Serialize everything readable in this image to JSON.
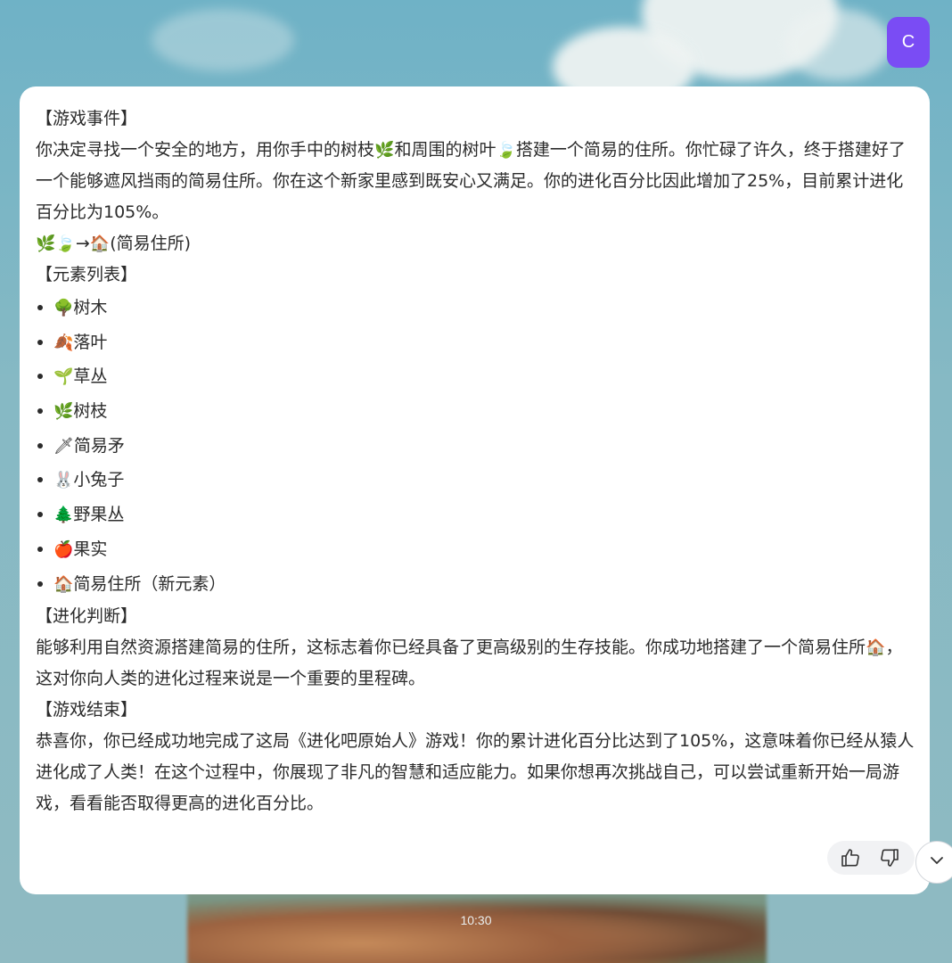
{
  "avatar": {
    "letter": "C",
    "color": "#7a4cf4"
  },
  "message": {
    "event_header": "【游戏事件】",
    "event_text": {
      "part1": "你决定寻找一个安全的地方，用你手中的树枝",
      "emoji_branch": "🌿",
      "part2": "和周围的树叶",
      "emoji_leaf": "🍃",
      "part3": "搭建一个简易的住所。你忙碌了许久，终于搭建好了一个能够遮风挡雨的简易住所。你在这个新家里感到既安心又满足。你的进化百分比因此增加了25%，目前累计进化百分比为105%。"
    },
    "formula": {
      "emoji_branch": "🌿",
      "emoji_leaf": "🍃",
      "arrow": "→",
      "emoji_house": "🏠",
      "label": "(简易住所)"
    },
    "elements_header": "【元素列表】",
    "elements": [
      {
        "icon": "🌳",
        "label": "树木"
      },
      {
        "icon": "🍂",
        "label": "落叶"
      },
      {
        "icon": "🌱",
        "label": "草丛"
      },
      {
        "icon": "🌿",
        "label": "树枝"
      },
      {
        "icon": "🗡",
        "label": "简易矛"
      },
      {
        "icon": "🐰",
        "label": "小兔子"
      },
      {
        "icon": "🌲",
        "label": "野果丛"
      },
      {
        "icon": "🍎",
        "label": "果实"
      },
      {
        "icon": "🏠",
        "label": "简易住所（新元素）"
      }
    ],
    "judgement_header": "【进化判断】",
    "judgement_text": {
      "part1": "能够利用自然资源搭建简易的住所，这标志着你已经具备了更高级别的生存技能。你成功地搭建了一个简易住所",
      "emoji_house": "🏠",
      "part2": "，这对你向人类的进化过程来说是一个重要的里程碑。"
    },
    "end_header": "【游戏结束】",
    "end_text": "恭喜你，你已经成功地完成了这局《进化吧原始人》游戏！你的累计进化百分比达到了105%，这意味着你已经从猿人进化成了人类！在这个过程中，你展现了非凡的智慧和适应能力。如果你想再次挑战自己，可以尝试重新开始一局游戏，看看能否取得更高的进化百分比。"
  },
  "actions": {
    "like_icon": "thumbs-up-icon",
    "dislike_icon": "thumbs-down-icon",
    "scroll_icon": "chevron-down-icon"
  },
  "timestamp": "10:30"
}
